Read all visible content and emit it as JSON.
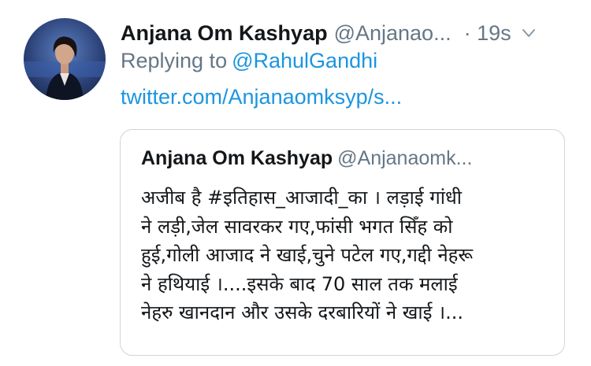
{
  "tweet": {
    "author": {
      "display_name": "Anjana Om Kashyap",
      "handle": "@Anjanao...",
      "avatar_icon": "avatar-photo"
    },
    "time": "· 19s",
    "caret_icon": "chevron-down-icon",
    "reply": {
      "prefix": "Replying to",
      "mention": "@RahulGandhi"
    },
    "link": "twitter.com/Anjanaomksyp/s..."
  },
  "quote": {
    "author": {
      "display_name": "Anjana Om Kashyap",
      "handle": "@Anjanaomk..."
    },
    "lines": [
      "अजीब है #इतिहास_आजादी_का । लड़ाई गांधी",
      "ने लड़ी,जेल सावरकर गए,फांसी भगत सिँह को",
      "हुई,गोली आजाद ने खाई,चुने पटेल गए,गद्दी नेहरू",
      "ने हथियाई ।....इसके बाद 70 साल तक मलाई",
      "नेहरु खानदान और उसके दरबारियों ने खाई ।..."
    ]
  },
  "colors": {
    "text": "#14171a",
    "secondary": "#657786",
    "link": "#1b95e0",
    "border": "#ccd6dd"
  }
}
